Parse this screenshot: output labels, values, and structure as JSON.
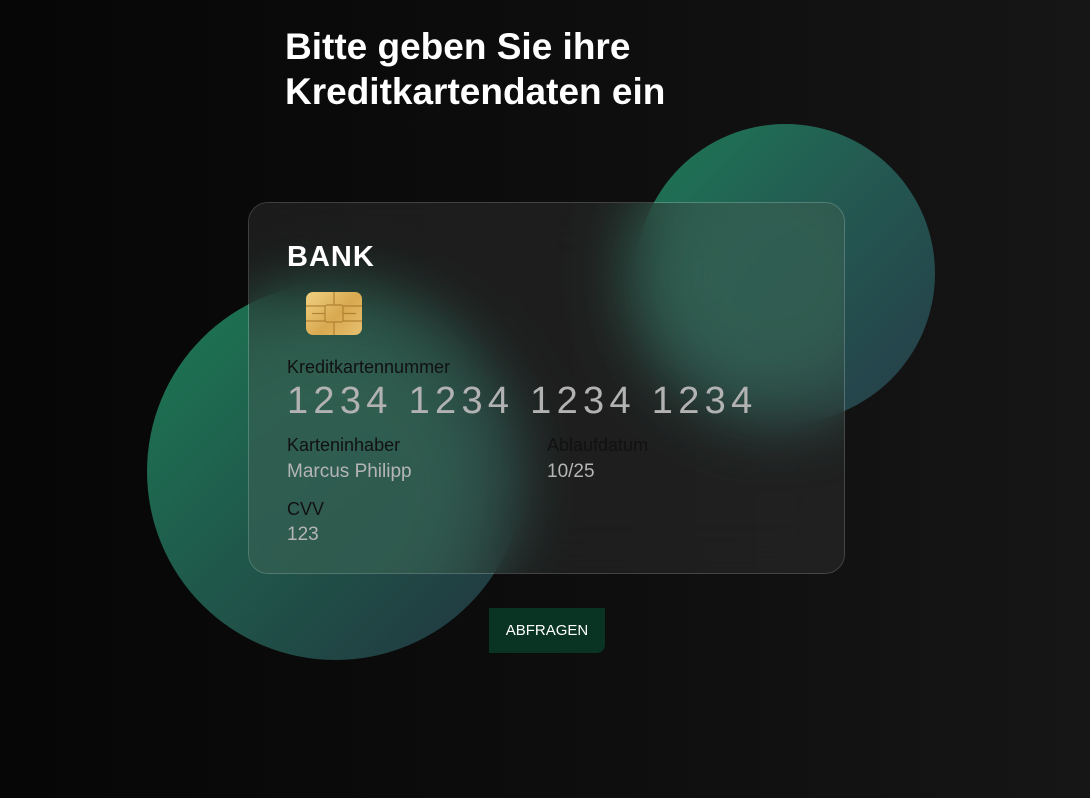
{
  "heading": "Bitte geben Sie ihre Kreditkartendaten ein",
  "card": {
    "bank_name": "BANK",
    "number_label": "Kreditkartennummer",
    "number_value": "1234 1234 1234 1234",
    "holder_label": "Karteninhaber",
    "holder_value": "Marcus Philipp",
    "expiry_label": "Ablaufdatum",
    "expiry_value": "10/25",
    "cvv_label": "CVV",
    "cvv_value": "123"
  },
  "submit_label": "ABFRAGEN",
  "icons": {
    "chip": "card-chip-icon"
  },
  "colors": {
    "accent_green": "#1c7a55",
    "button_bg": "#093424",
    "chip_gold": "#e2b863"
  }
}
